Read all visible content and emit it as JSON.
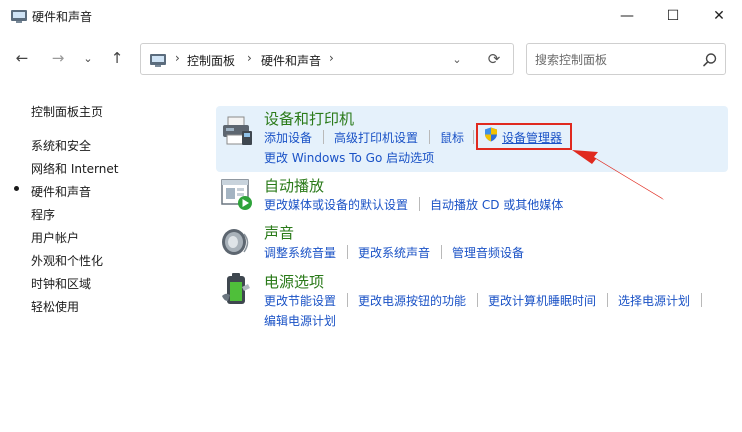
{
  "window": {
    "title": "硬件和声音",
    "minimize": "—",
    "maximize": "☐",
    "close": "✕"
  },
  "nav": {
    "back": "←",
    "forward": "→",
    "recent": "⌄",
    "up": "↑",
    "dropdown": "⌄",
    "refresh": "⟳"
  },
  "address": {
    "sep": "›",
    "crumbs": [
      "控制面板",
      "硬件和声音"
    ]
  },
  "search": {
    "placeholder": "搜索控制面板"
  },
  "sidebar": {
    "items": [
      "控制面板主页",
      "系统和安全",
      "网络和 Internet",
      "硬件和声音",
      "程序",
      "用户帐户",
      "外观和个性化",
      "时钟和区域",
      "轻松使用"
    ],
    "selected": "硬件和声音"
  },
  "categories": [
    {
      "title": "设备和打印机",
      "links": [
        "添加设备",
        "高级打印机设置",
        "鼠标",
        "设备管理器",
        "更改 Windows To Go 启动选项"
      ]
    },
    {
      "title": "自动播放",
      "links": [
        "更改媒体或设备的默认设置",
        "自动播放 CD 或其他媒体"
      ]
    },
    {
      "title": "声音",
      "links": [
        "调整系统音量",
        "更改系统声音",
        "管理音频设备"
      ]
    },
    {
      "title": "电源选项",
      "links": [
        "更改节能设置",
        "更改电源按钮的功能",
        "更改计算机睡眠时间",
        "选择电源计划",
        "编辑电源计划"
      ]
    }
  ],
  "colors": {
    "category_title": "#2a7a19",
    "link": "#1a52c6",
    "highlight": "#e5f1fb",
    "annotation": "#e02a1f"
  },
  "icons": {
    "app": "control-panel-icon",
    "devices": "printer-icon",
    "autoplay": "autoplay-icon",
    "sound": "speaker-icon",
    "power": "battery-icon",
    "device_manager": "uac-shield-icon"
  }
}
